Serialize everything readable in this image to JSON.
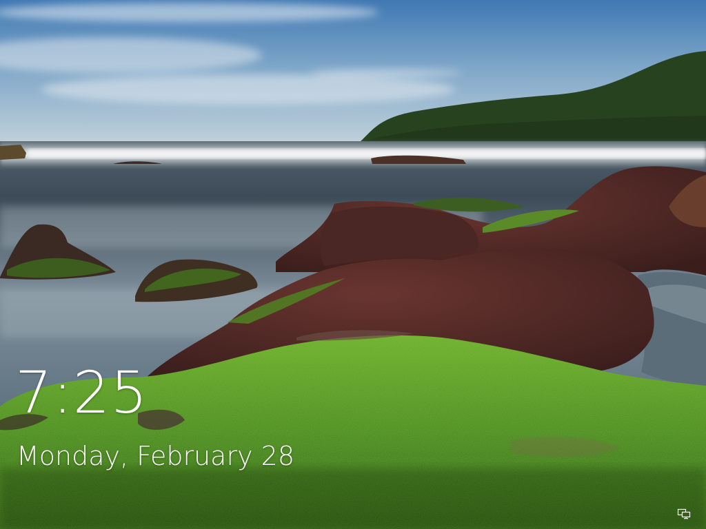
{
  "lock_screen": {
    "time": "7:25",
    "date": "Monday, February 28"
  },
  "status_icons": {
    "network": "network-wired-icon"
  },
  "colors": {
    "text": "#ffffff",
    "moss": "#4c8a1e",
    "rock": "#4a2522",
    "water": "#6a7f8c",
    "sky": "#6d9bbf"
  }
}
